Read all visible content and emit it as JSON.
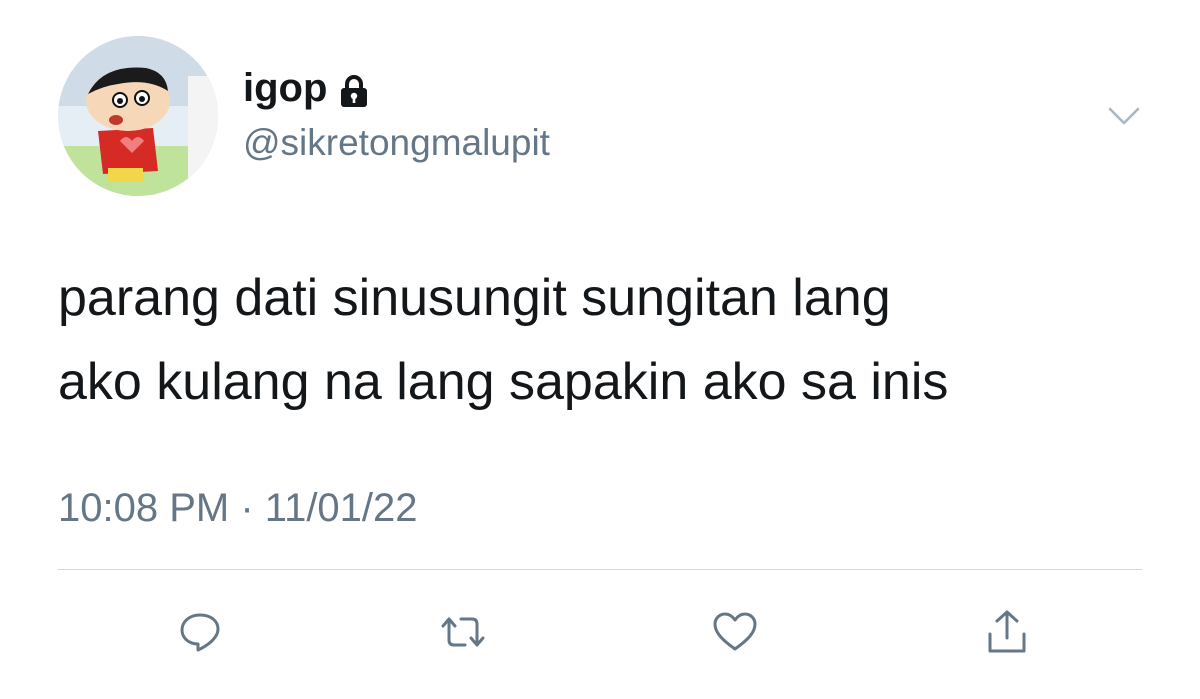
{
  "user": {
    "display_name": "igop",
    "handle": "@sikretongmalupit",
    "protected_icon": "lock-icon",
    "avatar_icon": "cartoon-avatar"
  },
  "tweet": {
    "text": "parang dati sinusungit sungitan lang\nako kulang na lang sapakin ako sa inis",
    "time": "10:08 PM",
    "separator": "·",
    "date": "11/01/22"
  },
  "actions": {
    "reply": "reply-icon",
    "retweet": "retweet-icon",
    "like": "heart-icon",
    "share": "share-icon",
    "menu": "chevron-down-icon"
  },
  "colors": {
    "text_primary": "#14171a",
    "text_secondary": "#657786",
    "divider": "#d4dbe0",
    "icon": "#657786"
  }
}
